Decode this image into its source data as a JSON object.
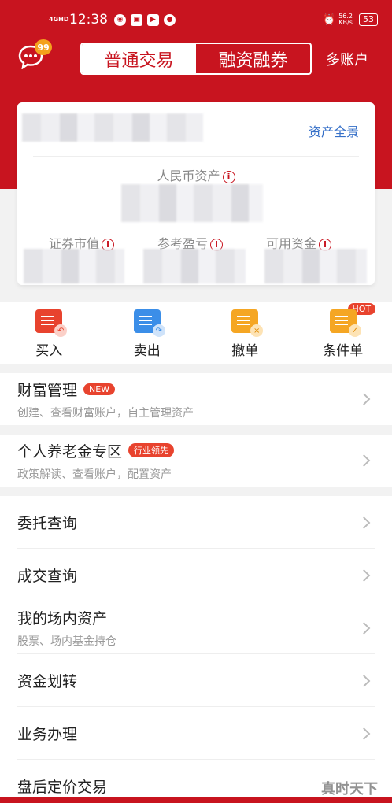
{
  "status": {
    "network": "4GHD",
    "time": "12:38",
    "speed_value": "56.2",
    "speed_unit": "KB/s",
    "battery": "53"
  },
  "header": {
    "badge": "99",
    "tabs": [
      {
        "label": "普通交易",
        "active": true
      },
      {
        "label": "融资融券",
        "active": false
      }
    ],
    "multi_account": "多账户"
  },
  "asset_card": {
    "overview_link": "资产全景",
    "rmb_assets_label": "人民币资产",
    "stats": [
      {
        "label": "证券市值"
      },
      {
        "label": "参考盈亏"
      },
      {
        "label": "可用资金"
      }
    ]
  },
  "actions": [
    {
      "label": "买入",
      "icon": "buy-icon",
      "color": "#e8432e"
    },
    {
      "label": "卖出",
      "icon": "sell-icon",
      "color": "#3b8ee8"
    },
    {
      "label": "撤单",
      "icon": "cancel-order-icon",
      "color": "#f5a623"
    },
    {
      "label": "条件单",
      "icon": "condition-order-icon",
      "color": "#f5a623",
      "badge": "HOT"
    }
  ],
  "menu": {
    "wealth": {
      "title": "财富管理",
      "tag": "NEW",
      "sub": "创建、查看财富账户，自主管理资产"
    },
    "pension": {
      "title": "个人养老金专区",
      "tag": "行业领先",
      "sub": "政策解读、查看账户，配置资产"
    },
    "items": [
      {
        "title": "委托查询"
      },
      {
        "title": "成交查询"
      },
      {
        "title": "我的场内资产",
        "sub": "股票、场内基金持仓"
      },
      {
        "title": "资金划转"
      },
      {
        "title": "业务办理"
      },
      {
        "title": "盘后定价交易"
      }
    ]
  },
  "watermark": "真时天下"
}
